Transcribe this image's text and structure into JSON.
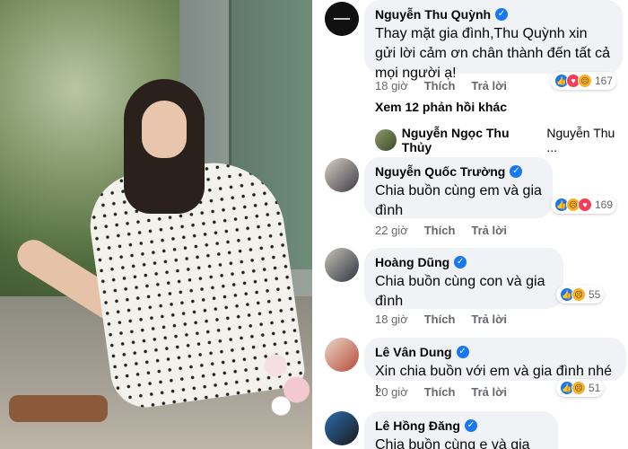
{
  "comments": [
    {
      "author": "Nguyễn Thu Quỳnh",
      "text": "Thay mặt gia đình,Thu Quỳnh xin gửi lời cảm ơn chân thành đến tất cả mọi người ạ!",
      "time": "18 giờ",
      "like_label": "Thích",
      "reply_label": "Trả lời",
      "reaction_count": "167"
    },
    {
      "author": "Nguyễn Quốc Trường",
      "text": "Chia buồn cùng em và gia đình",
      "time": "22 giờ",
      "like_label": "Thích",
      "reply_label": "Trả lời",
      "reaction_count": "169"
    },
    {
      "author": "Hoàng Dũng",
      "text": "Chia buồn cùng con và gia đình",
      "time": "18 giờ",
      "like_label": "Thích",
      "reply_label": "Trả lời",
      "reaction_count": "55"
    },
    {
      "author": "Lê Vân Dung",
      "text": "Xin chia buồn với em và gia đình nhé !",
      "time": "20 giờ",
      "like_label": "Thích",
      "reply_label": "Trả lời",
      "reaction_count": "51"
    },
    {
      "author": "Lê Hồng Đăng",
      "text": "Chia buồn cùng e và gia"
    }
  ],
  "more_replies": "Xem 12 phản hồi khác",
  "reply_preview": {
    "author": "Nguyễn Ngọc Thu Thủy",
    "text": "Nguyễn Thu ..."
  },
  "colors": {
    "bubble": "#f0f2f5",
    "verified": "#1877f2",
    "meta_text": "#65676b"
  }
}
